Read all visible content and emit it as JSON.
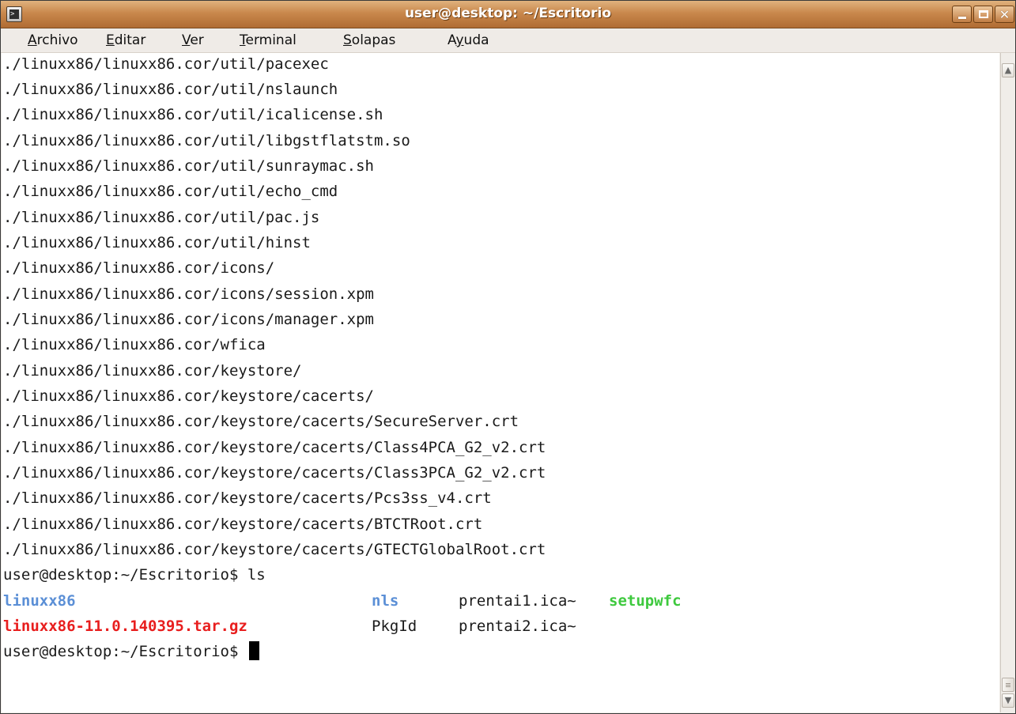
{
  "window": {
    "title": "user@desktop: ~/Escritorio",
    "menu": [
      {
        "label": "Archivo",
        "mnemonic": "A",
        "rest": "rchivo"
      },
      {
        "label": "Editar",
        "mnemonic": "E",
        "rest": "ditar"
      },
      {
        "label": "Ver",
        "mnemonic": "V",
        "rest": "er"
      },
      {
        "label": "Terminal",
        "mnemonic": "T",
        "rest": "erminal"
      },
      {
        "label": "Solapas",
        "mnemonic": "S",
        "rest": "olapas"
      },
      {
        "label": "Ayuda",
        "pre": "A",
        "mnemonic": "y",
        "rest": "uda"
      }
    ]
  },
  "terminal": {
    "lines": [
      "./linuxx86/linuxx86.cor/util/pacexec",
      "./linuxx86/linuxx86.cor/util/nslaunch",
      "./linuxx86/linuxx86.cor/util/icalicense.sh",
      "./linuxx86/linuxx86.cor/util/libgstflatstm.so",
      "./linuxx86/linuxx86.cor/util/sunraymac.sh",
      "./linuxx86/linuxx86.cor/util/echo_cmd",
      "./linuxx86/linuxx86.cor/util/pac.js",
      "./linuxx86/linuxx86.cor/util/hinst",
      "./linuxx86/linuxx86.cor/icons/",
      "./linuxx86/linuxx86.cor/icons/session.xpm",
      "./linuxx86/linuxx86.cor/icons/manager.xpm",
      "./linuxx86/linuxx86.cor/wfica",
      "./linuxx86/linuxx86.cor/keystore/",
      "./linuxx86/linuxx86.cor/keystore/cacerts/",
      "./linuxx86/linuxx86.cor/keystore/cacerts/SecureServer.crt",
      "./linuxx86/linuxx86.cor/keystore/cacerts/Class4PCA_G2_v2.crt",
      "./linuxx86/linuxx86.cor/keystore/cacerts/Class3PCA_G2_v2.crt",
      "./linuxx86/linuxx86.cor/keystore/cacerts/Pcs3ss_v4.crt",
      "./linuxx86/linuxx86.cor/keystore/cacerts/BTCTRoot.crt",
      "./linuxx86/linuxx86.cor/keystore/cacerts/GTECTGlobalRoot.crt"
    ],
    "ls_command": "user@desktop:~/Escritorio$ ls",
    "ls_rows": [
      [
        {
          "text": "linuxx86",
          "color": "blue",
          "kind": "directory"
        },
        {
          "text": "nls",
          "color": "blue",
          "kind": "directory"
        },
        {
          "text": "prentai1.ica~",
          "color": "default",
          "kind": "file"
        },
        {
          "text": "setupwfc",
          "color": "green",
          "kind": "executable"
        }
      ],
      [
        {
          "text": "linuxx86-11.0.140395.tar.gz",
          "color": "red",
          "kind": "archive"
        },
        {
          "text": "PkgId",
          "color": "default",
          "kind": "file"
        },
        {
          "text": "prentai2.ica~",
          "color": "default",
          "kind": "file"
        }
      ]
    ],
    "prompt": "user@desktop:~/Escritorio$ ",
    "colors": {
      "directory": "#5b8fd6",
      "archive": "#e81e1e",
      "executable": "#3ec93e",
      "text": "#1a1a1a",
      "background": "#ffffff"
    }
  },
  "icons": {
    "window_icon": "terminal-icon",
    "minimize": "minimize-icon",
    "maximize": "maximize-icon",
    "close": "close-icon"
  },
  "theme": {
    "titlebar_accent": "#c9884c",
    "menubar_bg": "#efebe7"
  }
}
